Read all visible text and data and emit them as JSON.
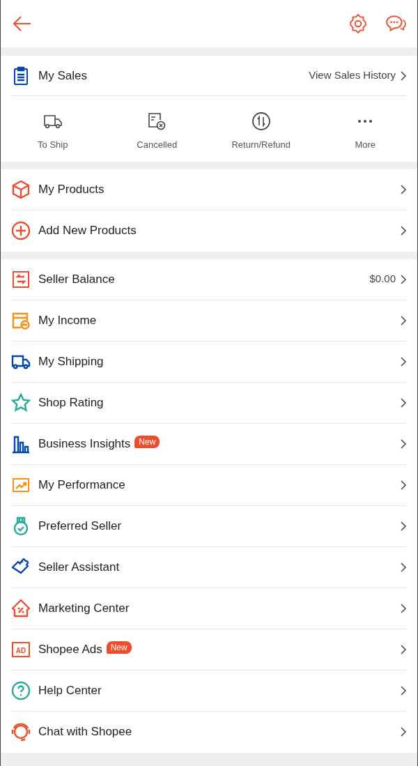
{
  "sales": {
    "title": "My Sales",
    "link": "View Sales History",
    "actions": [
      {
        "kind": "truck",
        "label": "To Ship"
      },
      {
        "kind": "cancel",
        "label": "Cancelled"
      },
      {
        "kind": "swap",
        "label": "Return/Refund"
      },
      {
        "kind": "dots",
        "label": "More"
      }
    ]
  },
  "groups": [
    [
      {
        "kind": "box",
        "color": "#ee4d2d",
        "label": "My Products"
      },
      {
        "kind": "plus",
        "color": "#ee4d2d",
        "label": "Add New Products"
      }
    ],
    [
      {
        "kind": "balance",
        "color": "#ee4d2d",
        "label": "Seller Balance",
        "value": "$0.00"
      },
      {
        "kind": "income",
        "color": "#f69113",
        "label": "My Income"
      },
      {
        "kind": "truck",
        "color": "#0046ab",
        "label": "My Shipping"
      },
      {
        "kind": "star",
        "color": "#26aa99",
        "label": "Shop Rating"
      },
      {
        "kind": "bars",
        "color": "#0046ab",
        "label": "Business Insights",
        "badge": "New"
      },
      {
        "kind": "chart",
        "color": "#f69113",
        "label": "My Performance"
      },
      {
        "kind": "medal",
        "color": "#26aa99",
        "label": "Preferred Seller"
      },
      {
        "kind": "puzzle",
        "color": "#0046ab",
        "label": "Seller Assistant"
      },
      {
        "kind": "house",
        "color": "#ee4d2d",
        "label": "Marketing Center"
      },
      {
        "kind": "ad",
        "color": "#ee4d2d",
        "label": "Shopee Ads",
        "icon_text": "AD",
        "badge": "New"
      },
      {
        "kind": "help",
        "color": "#26aa99",
        "label": "Help Center"
      },
      {
        "kind": "headset",
        "color": "#ee4d2d",
        "label": "Chat with Shopee"
      }
    ]
  ]
}
